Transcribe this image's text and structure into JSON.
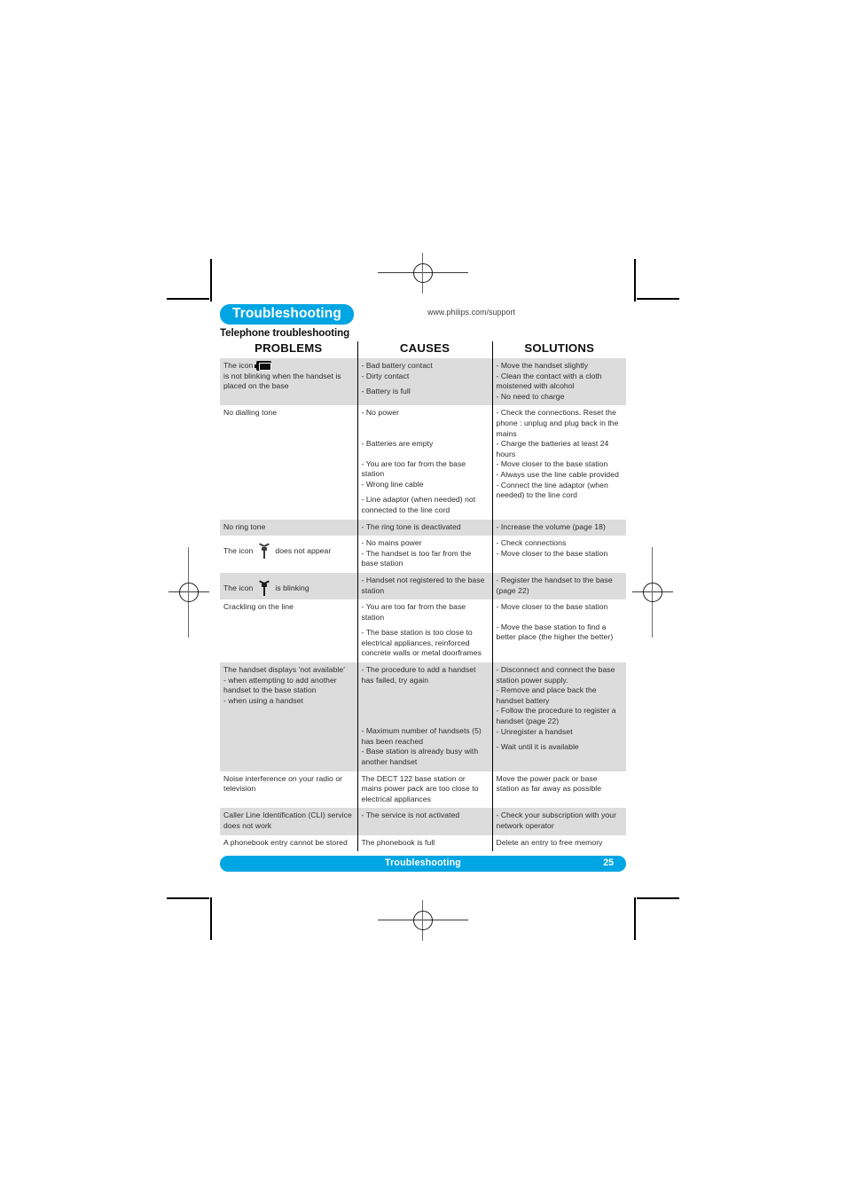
{
  "header": {
    "chip_label": "Troubleshooting",
    "web_url": "www.philips.com/support",
    "subtitle": "Telephone troubleshooting"
  },
  "table": {
    "columns": [
      "PROBLEMS",
      "CAUSES",
      "SOLUTIONS"
    ],
    "rows": [
      {
        "shaded": true,
        "problem": {
          "icon": "battery-icon",
          "text_before": "The icon",
          "text_after": "is not blinking when the handset is placed on the base"
        },
        "causes": [
          "- Bad battery contact",
          "- Dirty contact",
          "- Battery is full"
        ],
        "solutions": [
          "- Move the handset slightly",
          "- Clean the contact with a cloth moistened with alcohol",
          "- No need to charge"
        ]
      },
      {
        "shaded": false,
        "problem": {
          "text": "No dialling tone"
        },
        "causes": [
          "- No power",
          "- Batteries are empty",
          "- You are too far from the base station",
          "- Wrong line cable",
          "- Line adaptor (when needed) not connected to the line cord"
        ],
        "solutions": [
          "- Check the connections. Reset the phone : unplug and plug back in the mains",
          "- Charge the batteries at least 24 hours",
          "- Move closer to the base station",
          "- Always use the line cable provided",
          "- Connect the line adaptor (when needed) to the line cord"
        ]
      },
      {
        "shaded": true,
        "problem": {
          "text": "No ring tone"
        },
        "causes": [
          "- The ring tone is deactivated"
        ],
        "solutions": [
          "- Increase the volume (page 18)"
        ]
      },
      {
        "shaded": false,
        "problem": {
          "icon": "antenna-icon",
          "text_before": "The icon",
          "text_after": "does not appear"
        },
        "causes": [
          "- No mains power",
          "- The handset is too far from the base station"
        ],
        "solutions": [
          "- Check connections",
          "- Move closer to the base station"
        ]
      },
      {
        "shaded": true,
        "problem": {
          "icon": "antenna-blinking-icon",
          "text_before": "The icon",
          "text_after": "is blinking"
        },
        "causes": [
          "- Handset not registered to the base station"
        ],
        "solutions": [
          "- Register the handset to the base (page 22)"
        ]
      },
      {
        "shaded": false,
        "problem": {
          "text": "Crackling on the line"
        },
        "causes": [
          "- You are too far from the base station",
          "- The base station is too close to electrical appliances, reinforced concrete walls or metal doorframes"
        ],
        "solutions": [
          "- Move closer to the base station",
          "- Move the base station to find a better place (the higher the better)"
        ]
      },
      {
        "shaded": true,
        "problem": {
          "lines": [
            "The handset displays 'not available'",
            "- when attempting to add another handset to the base station",
            "- when using a handset"
          ]
        },
        "causes": [
          "- The procedure to add a handset has failed, try again",
          "- Maximum number of handsets (5) has been reached",
          "- Base station is already busy with another handset"
        ],
        "solutions": [
          "- Disconnect and connect the base station power supply.",
          "- Remove and place back the handset battery",
          "- Follow the procedure to register a handset (page 22)",
          "- Unregister a handset",
          "- Wait until it is available"
        ]
      },
      {
        "shaded": false,
        "problem": {
          "text": "Noise interference on your radio or television"
        },
        "causes": [
          "The DECT 122 base station or mains power pack are too close to electrical appliances"
        ],
        "solutions": [
          "Move the power pack or base station as far away as possible"
        ]
      },
      {
        "shaded": true,
        "problem": {
          "text": "Caller Line Identification (CLI) service does not work"
        },
        "causes": [
          "- The service is not activated"
        ],
        "solutions": [
          "- Check your subscription with your network operator"
        ]
      },
      {
        "shaded": false,
        "problem": {
          "text": "A phonebook entry cannot be stored"
        },
        "causes": [
          "The phonebook is full"
        ],
        "solutions": [
          "Delete an entry to free memory"
        ]
      }
    ]
  },
  "footer": {
    "title": "Troubleshooting",
    "page_number": "25"
  },
  "colors": {
    "brand_blue": "#00a5e3",
    "row_shade": "#dcdcdc"
  }
}
